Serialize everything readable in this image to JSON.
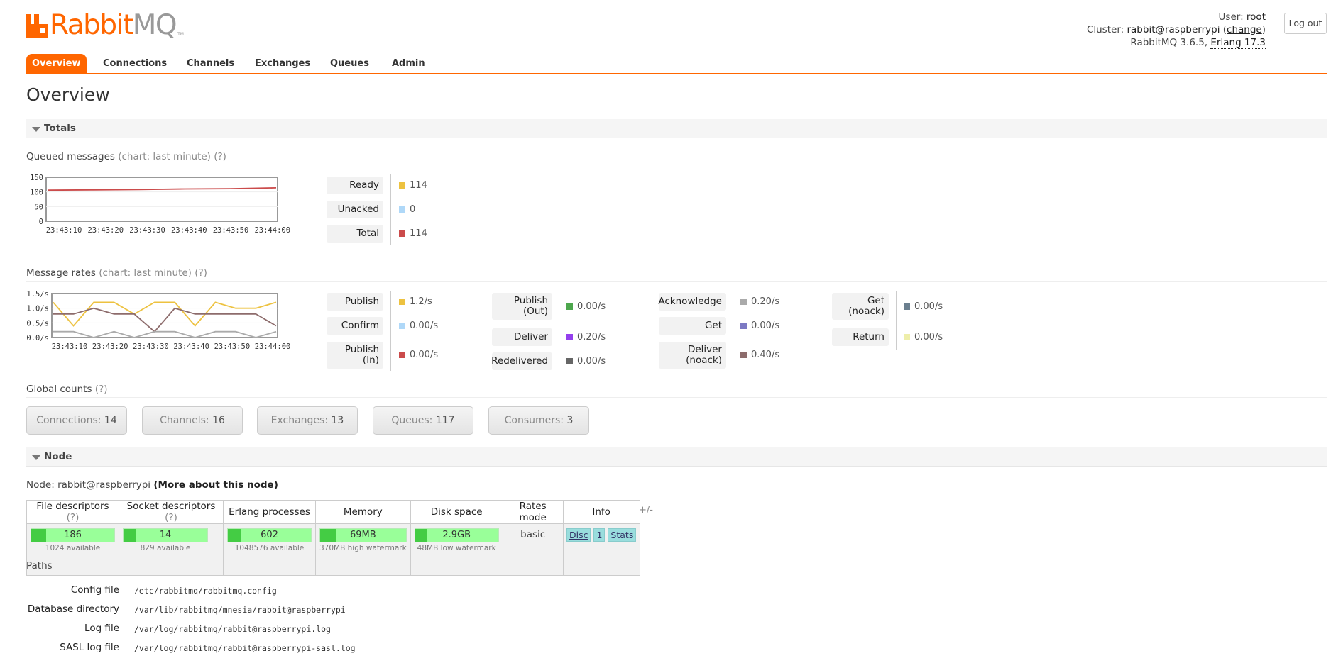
{
  "brand": {
    "name_main": "Rabbit",
    "name_suffix": "MQ",
    "tm": "TM",
    "color": "#ff6600"
  },
  "login": {
    "user_label": "User:",
    "user": "root",
    "cluster_label": "Cluster:",
    "cluster": "rabbit@raspberrypi",
    "change_link": "change",
    "version": "RabbitMQ 3.6.5,",
    "erlang": "Erlang 17.3",
    "logout": "Log out"
  },
  "menu": {
    "tabs": [
      "Overview",
      "Connections",
      "Channels",
      "Exchanges",
      "Queues",
      "Admin"
    ],
    "active": "Overview"
  },
  "page_title": "Overview",
  "totals": {
    "header": "Totals",
    "queued": {
      "title": "Queued messages",
      "hint": "(chart: last minute) (?)",
      "legend": [
        {
          "label": "Ready",
          "value": "114",
          "color": "#edc240"
        },
        {
          "label": "Unacked",
          "value": "0",
          "color": "#afd8f8"
        },
        {
          "label": "Total",
          "value": "114",
          "color": "#cb4b4b"
        }
      ]
    },
    "rates": {
      "title": "Message rates",
      "hint": "(chart: last minute) (?)",
      "col1": [
        {
          "label": "Publish",
          "value": "1.2/s",
          "color": "#edc240"
        },
        {
          "label": "Confirm",
          "value": "0.00/s",
          "color": "#afd8f8"
        },
        {
          "label": "Publish (In)",
          "value": "0.00/s",
          "color": "#cb4b4b"
        }
      ],
      "col2": [
        {
          "label": "Publish (Out)",
          "value": "0.00/s",
          "color": "#4da74d"
        },
        {
          "label": "Deliver",
          "value": "0.20/s",
          "color": "#9440ed"
        },
        {
          "label": "Redelivered",
          "value": "0.00/s",
          "color": "#666666"
        }
      ],
      "col3": [
        {
          "label": "Acknowledge",
          "value": "0.20/s",
          "color": "#aaaaaa"
        },
        {
          "label": "Get",
          "value": "0.00/s",
          "color": "#7c79c3"
        },
        {
          "label": "Deliver (noack)",
          "value": "0.40/s",
          "color": "#8d6c6c"
        }
      ],
      "col4": [
        {
          "label": "Get (noack)",
          "value": "0.00/s",
          "color": "#6b7f8f"
        },
        {
          "label": "Return",
          "value": "0.00/s",
          "color": "#eeeeaa"
        }
      ]
    },
    "global": {
      "title": "Global counts",
      "hint": "(?)",
      "counts": [
        {
          "label": "Connections:",
          "value": "14"
        },
        {
          "label": "Channels:",
          "value": "16"
        },
        {
          "label": "Exchanges:",
          "value": "13"
        },
        {
          "label": "Queues:",
          "value": "117"
        },
        {
          "label": "Consumers:",
          "value": "3"
        }
      ]
    }
  },
  "node": {
    "header": "Node",
    "line_label": "Node: rabbit@raspberrypi",
    "more": "(More about this node)",
    "columns": [
      "File descriptors",
      "Socket descriptors",
      "Erlang processes",
      "Memory",
      "Disk space",
      "Rates mode",
      "Info"
    ],
    "col_hint": "(?)",
    "fd": {
      "value": "186",
      "sub": "1024 available",
      "fraction": 0.18
    },
    "sockets": {
      "value": "14",
      "sub": "829 available",
      "fraction": 0.02
    },
    "procs": {
      "value": "602",
      "sub": "1048576 available",
      "fraction": 0.0
    },
    "memory": {
      "value": "69MB",
      "sub": "370MB high watermark",
      "fraction": 0.19
    },
    "disk": {
      "value": "2.9GB",
      "sub": "48MB low watermark",
      "fraction": 0.02
    },
    "rates_mode": "basic",
    "info": [
      "Disc",
      "1",
      "Stats"
    ],
    "plusminus": "+/-"
  },
  "paths": {
    "title": "Paths",
    "rows": [
      {
        "key": "Config file",
        "value": "/etc/rabbitmq/rabbitmq.config"
      },
      {
        "key": "Database directory",
        "value": "/var/lib/rabbitmq/mnesia/rabbit@raspberrypi"
      },
      {
        "key": "Log file",
        "value": "/var/log/rabbitmq/rabbit@raspberrypi.log"
      },
      {
        "key": "SASL log file",
        "value": "/var/log/rabbitmq/rabbit@raspberrypi-sasl.log"
      }
    ]
  },
  "chart_data": [
    {
      "type": "line",
      "x": [
        "23:43:10",
        "23:43:20",
        "23:43:30",
        "23:43:40",
        "23:43:50",
        "23:44:00"
      ],
      "yticks": [
        "150",
        "100",
        "50",
        "0"
      ],
      "ylim": [
        0,
        150
      ],
      "series": [
        {
          "name": "Total",
          "color": "#cb4b4b",
          "values": [
            106,
            107,
            108,
            110,
            111,
            114
          ]
        }
      ],
      "grid": true
    },
    {
      "type": "line",
      "x": [
        "23:43:10",
        "23:43:20",
        "23:43:30",
        "23:43:40",
        "23:43:50",
        "23:44:00"
      ],
      "yticks": [
        "1.5/s",
        "1.0/s",
        "0.5/s",
        "0.0/s"
      ],
      "ylim": [
        0,
        1.5
      ],
      "series": [
        {
          "name": "Publish",
          "color": "#edc240",
          "values": [
            1.2,
            0.4,
            1.2,
            1.2,
            0.8,
            1.2,
            1.2,
            0.4,
            1.2,
            1.0,
            1.0,
            1.2
          ]
        },
        {
          "name": "Deliver (noack)",
          "color": "#8d6c6c",
          "values": [
            0.8,
            0.8,
            1.0,
            0.8,
            0.8,
            0.2,
            1.0,
            0.8,
            0.8,
            0.8,
            0.8,
            0.4
          ]
        },
        {
          "name": "Acknowledge",
          "color": "#aaaaaa",
          "values": [
            0.2,
            0.2,
            0.0,
            0.2,
            0.0,
            0.2,
            0.2,
            0.0,
            0.2,
            0.2,
            0.0,
            0.2
          ]
        }
      ],
      "grid": true
    }
  ]
}
